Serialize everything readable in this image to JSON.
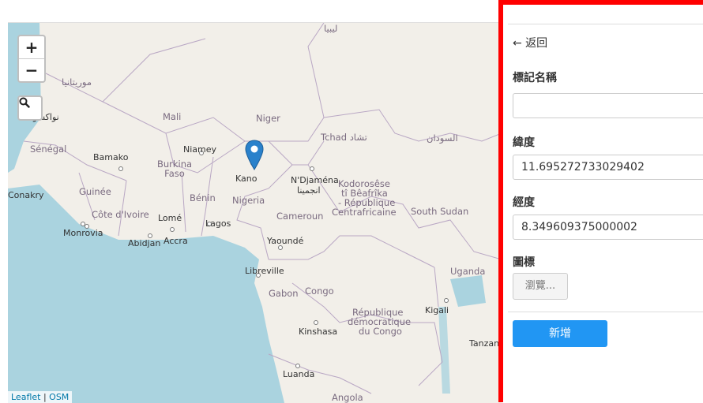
{
  "map": {
    "zoom_in": "+",
    "zoom_out": "−",
    "search_icon": "search-icon",
    "marker_icon": "map-marker-icon",
    "labels": [
      "ليبيا",
      "موريتانيا",
      "Mali",
      "Niger",
      "نواكشوط",
      "Sénégal",
      "Bamako",
      "Niamey",
      "Burkina Faso",
      "Tchad تشاد",
      "السودان",
      "Kano",
      "N'Djaména",
      "انجمينا",
      "Conakry",
      "Guinée",
      "Bénin",
      "Nigeria",
      "Kodorosêse",
      "tî Bêafrîka",
      "- République",
      "Centrafricaine",
      "South Sudan",
      "Côte d'Ivoire",
      "Lomé",
      "Lagos",
      "Cameroun",
      "Monrovia",
      "Abidjan",
      "Accra",
      "Yaoundé",
      "Libreville",
      "Gabon",
      "Congo",
      "Uganda",
      "République",
      "démocratique",
      "du Congo",
      "Kigali",
      "Kinshasa",
      "Tanzan",
      "Luanda",
      "Angola"
    ],
    "attribution_leaflet": "Leaflet",
    "attribution_sep": " | ",
    "attribution_osm": "OSM"
  },
  "panel": {
    "back_label": "← 返回",
    "name_label": "標記名稱",
    "name_value": "",
    "lat_label": "緯度",
    "lat_value": "11.695272733029402",
    "lng_label": "經度",
    "lng_value": "8.349609375000002",
    "icon_label": "圖標",
    "browse_label": "瀏覽...",
    "submit_label": "新增"
  },
  "colors": {
    "highlight_border": "#ff0000",
    "primary_button": "#2196f3",
    "marker": "#2a81cb",
    "sea": "#aad3df",
    "land": "#f2efe9"
  }
}
